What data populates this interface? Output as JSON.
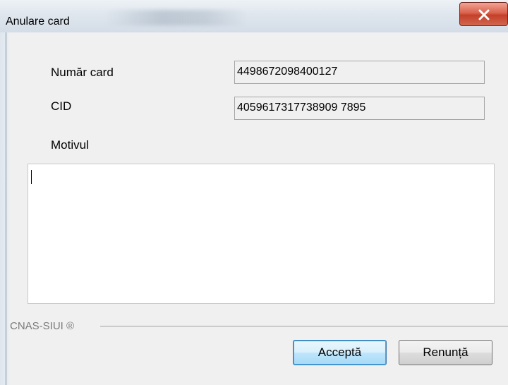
{
  "window": {
    "title": "Anulare card",
    "close_icon": "close-x-icon"
  },
  "form": {
    "card_number_label": "Număr card",
    "card_number_value": "4498672098400127",
    "cid_label": "CID",
    "cid_value": "4059617317738909 7895",
    "reason_label": "Motivul",
    "reason_value": ""
  },
  "footer": {
    "group_label": "CNAS-SIUI ®",
    "accept_label": "Acceptă",
    "cancel_label": "Renunță"
  },
  "colors": {
    "close_button": "#c3402a",
    "default_button_border": "#3c7fb1"
  }
}
